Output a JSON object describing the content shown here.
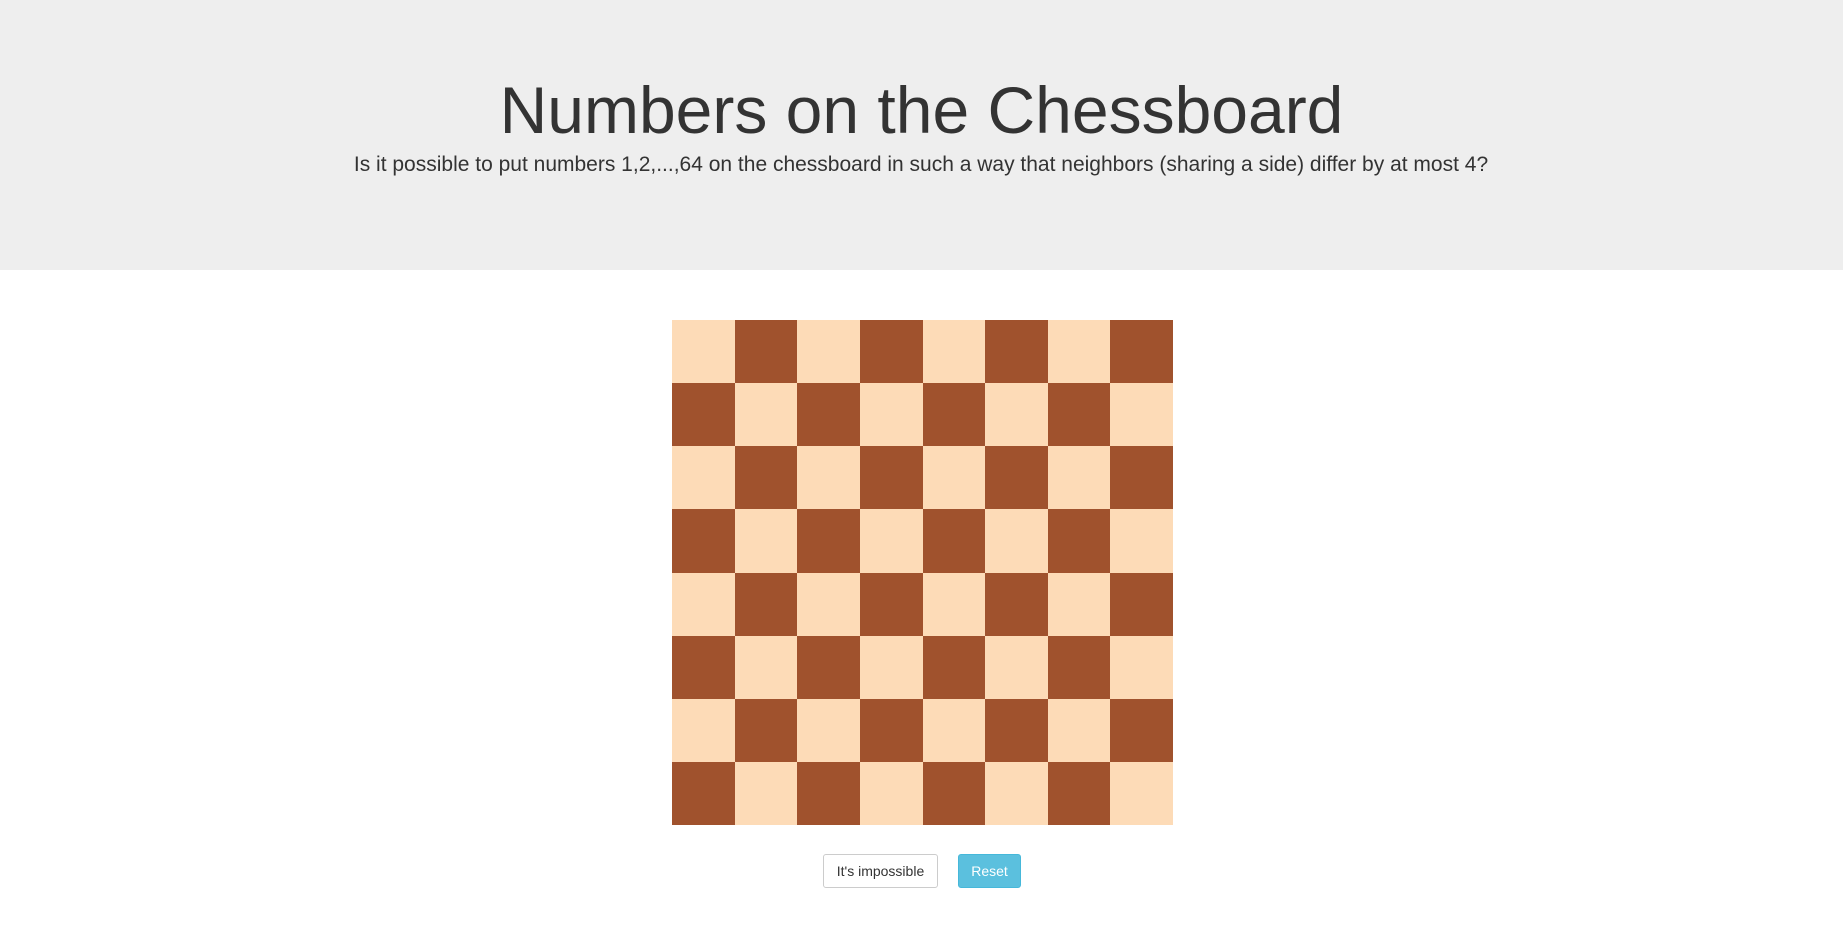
{
  "header": {
    "title": "Numbers on the Chessboard",
    "question": "Is it possible to put numbers 1,2,...,64 on the chessboard in such a way that neighbors (sharing a side) differ by at most 4?"
  },
  "board": {
    "rows": 8,
    "cols": 8,
    "light_color": "#fddbb7",
    "dark_color": "#a0522d",
    "cell_values": []
  },
  "actions": {
    "impossible_label": "It's impossible",
    "reset_label": "Reset"
  },
  "colors": {
    "header_bg": "#eeeeee",
    "reset_button": "#5bc0de"
  }
}
